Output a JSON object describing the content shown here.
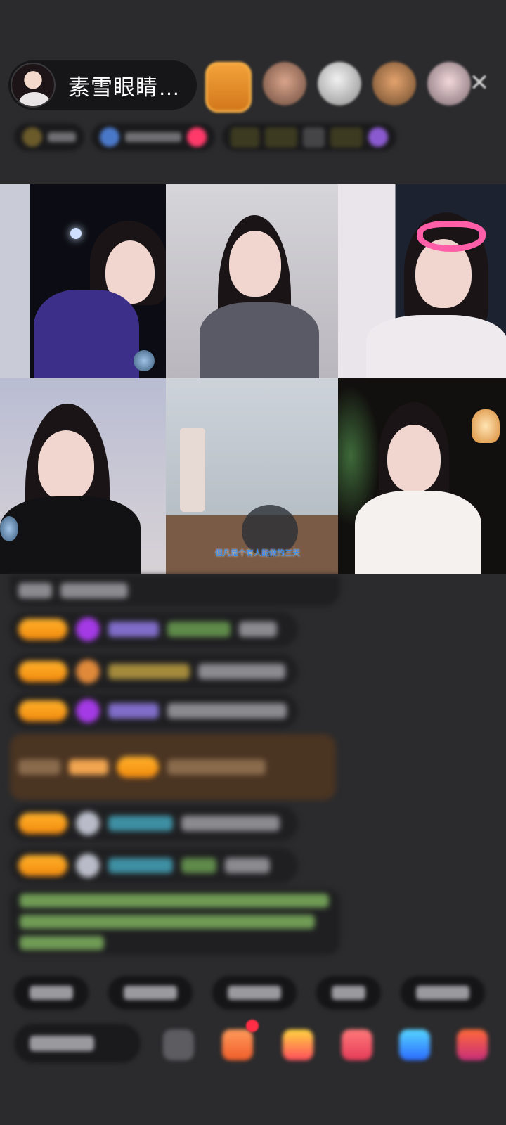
{
  "header": {
    "host_name": "素雪眼睛…",
    "close_icon": "✕"
  },
  "video_tiles": [
    {
      "name": "tile-1",
      "watermark": ""
    },
    {
      "name": "tile-2"
    },
    {
      "name": "tile-3"
    },
    {
      "name": "tile-4"
    },
    {
      "name": "tile-5",
      "subtitle": "但凡是个有人能做的三天"
    },
    {
      "name": "tile-6"
    }
  ],
  "icons": {
    "close": "close-icon",
    "avatar": "avatar",
    "gift": "gift-icon",
    "more": "more-icon"
  },
  "colors": {
    "background": "#2b2b2d",
    "badge": "#f28a0d",
    "accent_pink": "#ff5fa8"
  }
}
